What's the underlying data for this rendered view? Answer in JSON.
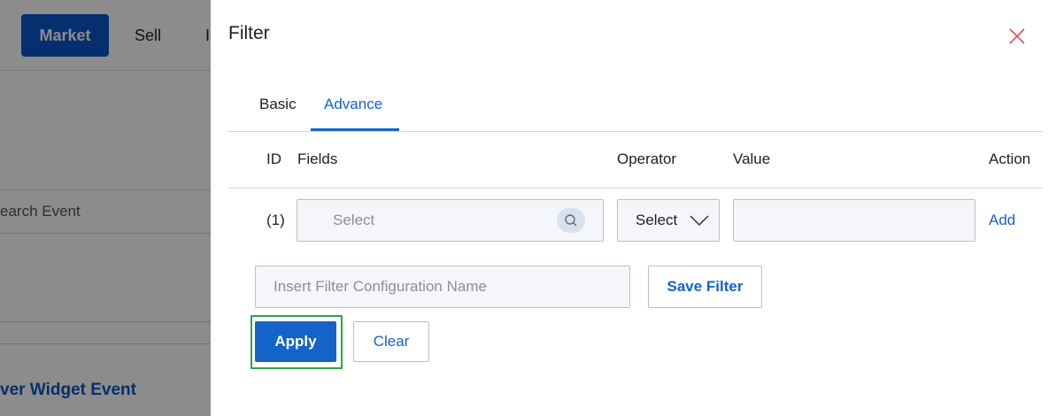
{
  "background": {
    "nav": {
      "market_label": "Market",
      "sell_label": "Sell",
      "more_label": "I"
    },
    "search_placeholder": "earch Event",
    "widget_link": "ver Widget Event"
  },
  "filter": {
    "title": "Filter",
    "close_icon": "close-x-icon",
    "tabs": [
      {
        "label": "Basic",
        "active": false
      },
      {
        "label": "Advance",
        "active": true
      }
    ],
    "table": {
      "headers": {
        "id": "ID",
        "fields": "Fields",
        "operator": "Operator",
        "value": "Value",
        "action": "Action"
      },
      "rows": [
        {
          "id": "(1)",
          "fields_placeholder": "Select",
          "operator_value": "Select",
          "value": "",
          "action_label": "Add"
        }
      ]
    },
    "config_name_placeholder": "Insert Filter Configuration Name",
    "save_filter_label": "Save Filter",
    "apply_label": "Apply",
    "clear_label": "Clear"
  },
  "colors": {
    "accent": "#1463c9",
    "highlight": "#2aa54a",
    "close_icon": "#d9534f"
  }
}
